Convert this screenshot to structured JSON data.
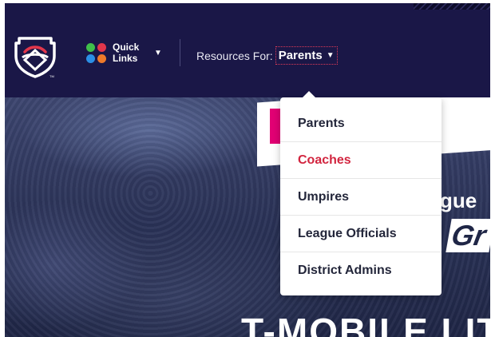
{
  "header": {
    "quick_links": {
      "label": "Quick\nLinks",
      "dot_colors": [
        "#3fbf4a",
        "#e2364b",
        "#2b8fe6",
        "#ee7a2a"
      ],
      "icon": "chevron-down-icon"
    },
    "resources": {
      "label": "Resources For:",
      "selected": "Parents",
      "icon": "caret-down-icon"
    }
  },
  "dropdown": {
    "items": [
      {
        "label": "Parents",
        "active": false
      },
      {
        "label": "Coaches",
        "active": true
      },
      {
        "label": "Umpires",
        "active": false
      },
      {
        "label": "League Officials",
        "active": false
      },
      {
        "label": "District Admins",
        "active": false
      }
    ]
  },
  "hero": {
    "word_1": "gue",
    "word_2": "Gr",
    "headline": "T-MOBILE LIT"
  },
  "colors": {
    "header_bg": "#1a1747",
    "accent": "#d2253f",
    "brand_magenta": "#e20074"
  }
}
